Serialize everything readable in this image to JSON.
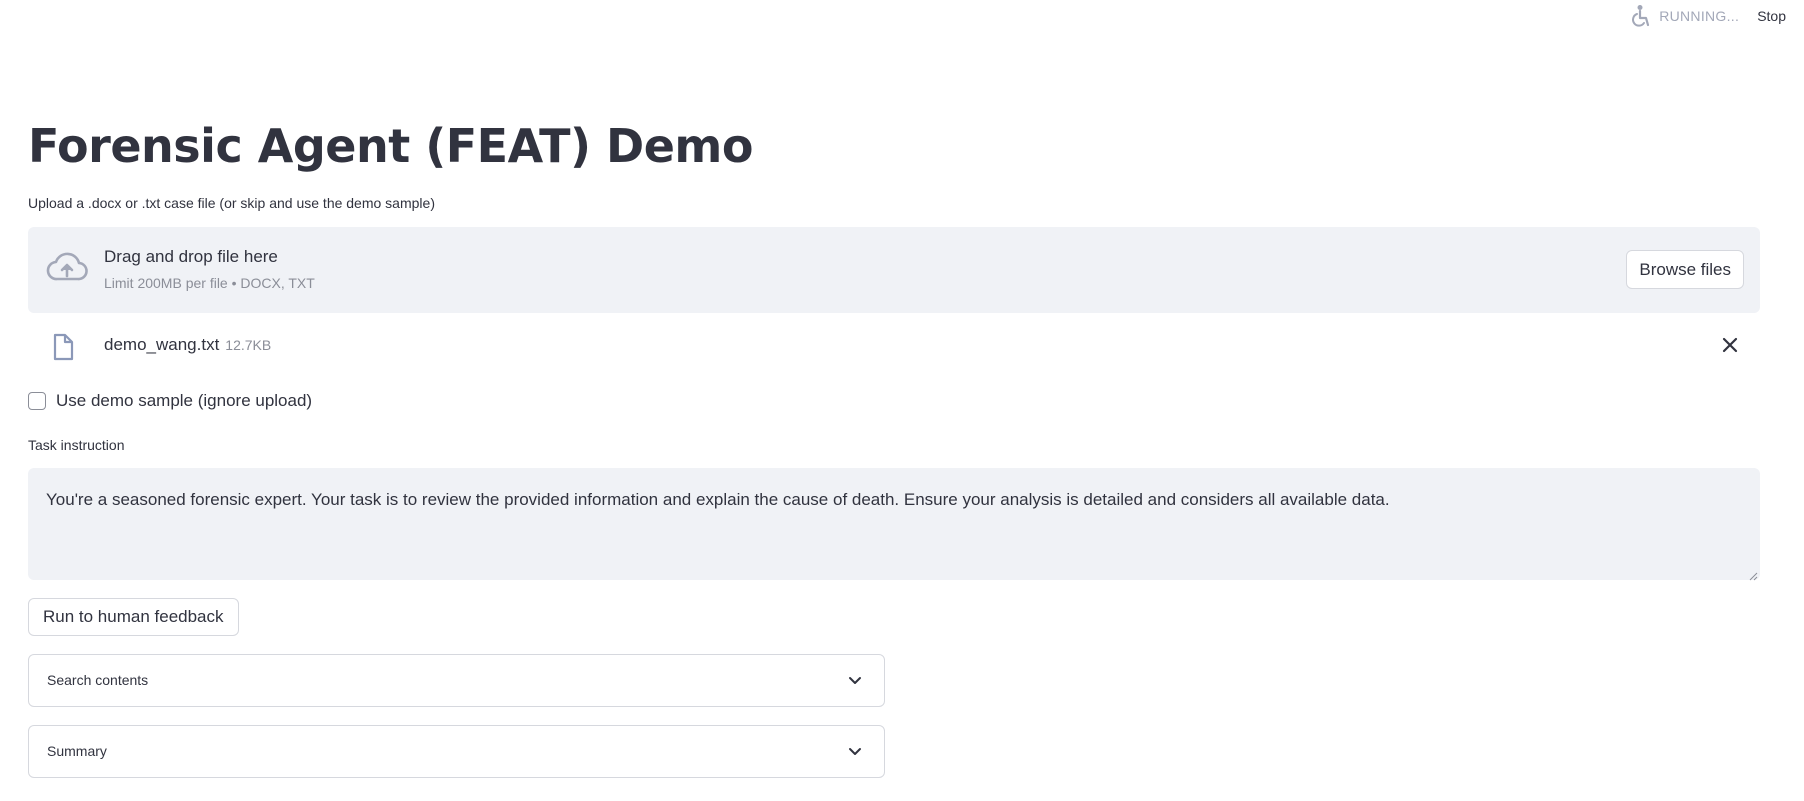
{
  "status": {
    "running_label": "RUNNING...",
    "stop_label": "Stop",
    "running_icon": "running-person-icon"
  },
  "page": {
    "title": "Forensic Agent (FEAT) Demo"
  },
  "uploader": {
    "label": "Upload a .docx or .txt case file (or skip and use the demo sample)",
    "drop_title": "Drag and drop file here",
    "drop_subtitle": "Limit 200MB per file • DOCX, TXT",
    "browse_label": "Browse files",
    "icon": "cloud-upload-icon"
  },
  "uploaded_file": {
    "name": "demo_wang.txt",
    "size": "12.7KB",
    "icon": "file-icon",
    "remove_icon": "close-icon"
  },
  "demo_checkbox": {
    "label": "Use demo sample (ignore upload)",
    "checked": false
  },
  "task": {
    "label": "Task instruction",
    "value": "You're a seasoned forensic expert. Your task is to review the provided information and explain the cause of death. Ensure your analysis is detailed and considers all available data."
  },
  "actions": {
    "run_label": "Run to human feedback"
  },
  "expanders": [
    {
      "label": "Search contents",
      "icon": "chevron-down-icon"
    },
    {
      "label": "Summary",
      "icon": "chevron-down-icon"
    }
  ],
  "colors": {
    "text": "#31333f",
    "muted": "#8b8e98",
    "panel_bg": "#f0f2f6",
    "border": "#d6d8de"
  }
}
